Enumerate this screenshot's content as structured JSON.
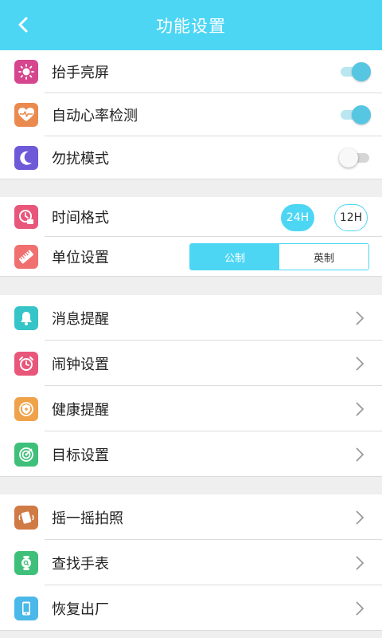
{
  "header": {
    "title": "功能设置",
    "bg": "#4dd6f4"
  },
  "group1": [
    {
      "label": "抬手亮屏",
      "icon": "sun-icon",
      "color": "#d6468f",
      "toggle": true
    },
    {
      "label": "自动心率检测",
      "icon": "heart-rate-icon",
      "color": "#ea8a4f",
      "toggle": true
    },
    {
      "label": "勿扰模式",
      "icon": "moon-icon",
      "color": "#6e59d8",
      "toggle": false
    }
  ],
  "group2": {
    "time_format": {
      "label": "时间格式",
      "icon": "clock-icon",
      "color": "#e8567a",
      "opt24": "24H",
      "opt12": "12H",
      "selected": "24H"
    },
    "unit": {
      "label": "单位设置",
      "icon": "ruler-icon",
      "color": "#f07070",
      "metric": "公制",
      "imperial": "英制",
      "selected": "公制"
    }
  },
  "group3": [
    {
      "label": "消息提醒",
      "icon": "bell-icon",
      "color": "#35c4c7"
    },
    {
      "label": "闹钟设置",
      "icon": "alarm-clock-icon",
      "color": "#e8567a"
    },
    {
      "label": "健康提醒",
      "icon": "health-shield-icon",
      "color": "#efa24a"
    },
    {
      "label": "目标设置",
      "icon": "target-icon",
      "color": "#3fc07a"
    }
  ],
  "group4": [
    {
      "label": "摇一摇拍照",
      "icon": "shake-camera-icon",
      "color": "#d07a45"
    },
    {
      "label": "查找手表",
      "icon": "watch-search-icon",
      "color": "#3fc07a"
    },
    {
      "label": "恢复出厂",
      "icon": "phone-reset-icon",
      "color": "#4ab8e8"
    }
  ]
}
